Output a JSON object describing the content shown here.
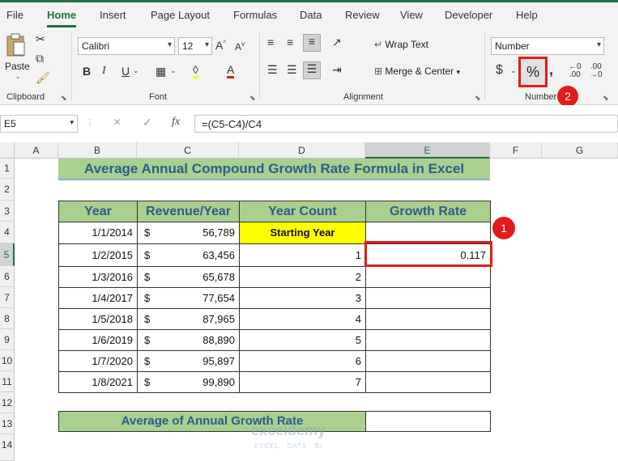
{
  "tabs": [
    "File",
    "Home",
    "Insert",
    "Page Layout",
    "Formulas",
    "Data",
    "Review",
    "View",
    "Developer",
    "Help"
  ],
  "ribbon": {
    "clipboard": {
      "paste": "Paste",
      "label": "Clipboard"
    },
    "font": {
      "name": "Calibri",
      "size": "12",
      "bold": "B",
      "italic": "I",
      "underline": "U",
      "grow": "A",
      "shrink": "A",
      "label": "Font"
    },
    "alignment": {
      "wrap": "Wrap Text",
      "merge": "Merge & Center",
      "label": "Alignment"
    },
    "number": {
      "format": "Number",
      "currency": "$",
      "percent": "%",
      "comma": ",",
      "label": "Number"
    }
  },
  "formula_bar": {
    "name_box": "E5",
    "cancel": "×",
    "enter": "✓",
    "fx": "fx",
    "formula": "=(C5-C4)/C4"
  },
  "columns": [
    "A",
    "B",
    "C",
    "D",
    "E",
    "F",
    "G"
  ],
  "rows": [
    "1",
    "2",
    "3",
    "4",
    "5",
    "6",
    "7",
    "8",
    "9",
    "10",
    "11",
    "12",
    "13",
    "14"
  ],
  "sheet": {
    "title": "Average Annual Compound Growth Rate Formula in Excel",
    "headers": [
      "Year",
      "Revenue/Year",
      "Year Count",
      "Growth Rate"
    ],
    "data": [
      {
        "year": "1/1/2014",
        "currency": "$",
        "revenue": "56,789",
        "count": "Starting Year",
        "growth": ""
      },
      {
        "year": "1/2/2015",
        "currency": "$",
        "revenue": "63,456",
        "count": "1",
        "growth": "0.117"
      },
      {
        "year": "1/3/2016",
        "currency": "$",
        "revenue": "65,678",
        "count": "2",
        "growth": ""
      },
      {
        "year": "1/4/2017",
        "currency": "$",
        "revenue": "77,654",
        "count": "3",
        "growth": ""
      },
      {
        "year": "1/5/2018",
        "currency": "$",
        "revenue": "87,965",
        "count": "4",
        "growth": ""
      },
      {
        "year": "1/6/2019",
        "currency": "$",
        "revenue": "88,890",
        "count": "5",
        "growth": ""
      },
      {
        "year": "1/7/2020",
        "currency": "$",
        "revenue": "95,897",
        "count": "6",
        "growth": ""
      },
      {
        "year": "1/8/2021",
        "currency": "$",
        "revenue": "99,890",
        "count": "7",
        "growth": ""
      }
    ],
    "average_label": "Average of Annual Growth Rate",
    "average_value": ""
  },
  "badges": {
    "one": "1",
    "two": "2"
  },
  "watermark": {
    "name": "exceldemy",
    "tagline": "EXCEL · DATA · BI"
  },
  "colors": {
    "accent": "#1e7145",
    "header_fill": "#a9d08e",
    "header_text": "#2e5c8a",
    "highlight": "#ffff00",
    "callout": "#e21b1b"
  }
}
